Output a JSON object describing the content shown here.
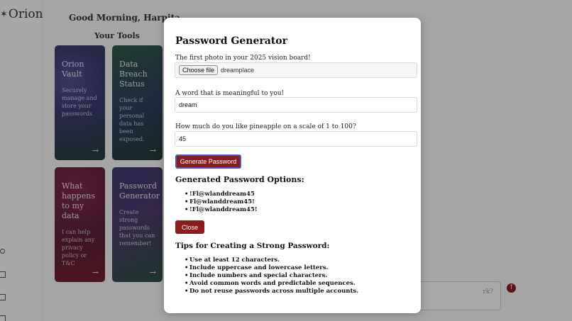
{
  "app": {
    "logo": "Orion",
    "greeting": "Good Morning, Harpita",
    "tools_title": "Your Tools",
    "cards": [
      {
        "title": "Orion Vault",
        "desc": "Securely manage and store your passwords",
        "arrow": "→"
      },
      {
        "title": "Data Breach Status",
        "desc": "Check if your personal data has been exposed.",
        "arrow": "→"
      },
      {
        "title": "What happens to my data",
        "desc": "I can help explain any privacy policy or T&C",
        "arrow": "→"
      },
      {
        "title": "Password Generator",
        "desc": "Create strong passwords that you can remember!",
        "arrow": "→"
      }
    ],
    "chat_placeholder_visible": "rk?",
    "send_icon": "↑"
  },
  "modal": {
    "title": "Password Generator",
    "q1_label": "The first photo in your 2025 vision board!",
    "file_button": "Choose file",
    "file_name": "dreamplace",
    "q2_label": "A word that is meaningful to you!",
    "q2_value": "dream",
    "q3_label": "How much do you like pineapple on a scale of 1 to 100?",
    "q3_value": "45",
    "generate_button": "Generate Password",
    "options_title": "Generated Password Options:",
    "options": [
      "!Fl@wlanddream45",
      "Fl@wlanddream45!",
      "!Fl@wlanddream45!"
    ],
    "close_button": "Close",
    "tips_title": "Tips for Creating a Strong Password:",
    "tips": [
      "Use at least 12 characters.",
      "Include uppercase and lowercase letters.",
      "Include numbers and special characters.",
      "Avoid common words and predictable sequences.",
      "Do not reuse passwords across multiple accounts."
    ]
  },
  "colors": {
    "accent": "#8b1c1c",
    "focus_ring": "#4c5bb8"
  }
}
